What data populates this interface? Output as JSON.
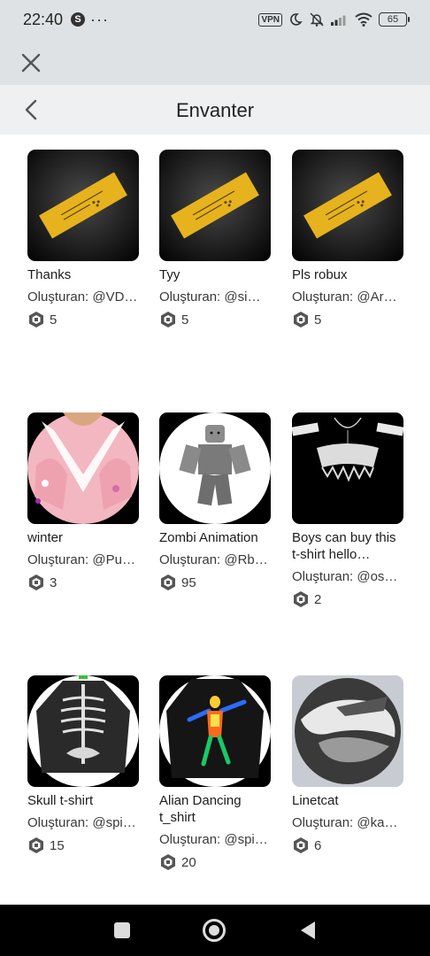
{
  "status_bar": {
    "time": "22:40",
    "vpn": "VPN",
    "battery": "65",
    "icons": [
      "app-s-icon",
      "more-dots-icon",
      "vpn-icon",
      "moon-icon",
      "bell-off-icon",
      "signal-icon",
      "wifi-icon",
      "battery-icon"
    ]
  },
  "header": {
    "title": "Envanter",
    "close_icon": "close-icon",
    "back_icon": "chevron-left-icon"
  },
  "items": [
    {
      "name": "Thanks",
      "creator": "Oluşturan: @VD…",
      "price": "5",
      "thumb": "gold-ticket"
    },
    {
      "name": "Tyy",
      "creator": "Oluşturan: @sim…",
      "price": "5",
      "thumb": "gold-ticket"
    },
    {
      "name": "Pls robux",
      "creator": "Oluşturan: @Ard…",
      "price": "5",
      "thumb": "gold-ticket"
    },
    {
      "name": "winter",
      "creator": "Oluşturan: @Pur…",
      "price": "3",
      "thumb": "pink-jacket"
    },
    {
      "name": "Zombi Animation",
      "creator": "Oluşturan: @Rb…",
      "price": "95",
      "thumb": "zombie-avatar"
    },
    {
      "name": "Boys can buy this t-shirt hello…",
      "creator": "Oluşturan: @os…",
      "price": "2",
      "thumb": "black-gothic-shirt"
    },
    {
      "name": "Skull t-shirt",
      "creator": "Oluşturan: @spi…",
      "price": "15",
      "thumb": "skeleton-shirt"
    },
    {
      "name": "Alian Dancing t_shirt",
      "creator": "Oluşturan: @spi…",
      "price": "20",
      "thumb": "thermal-alien-shirt"
    },
    {
      "name": "Linetcat",
      "creator": "Oluşturan: @kak…",
      "price": "6",
      "thumb": "grey-abstract"
    }
  ],
  "colors": {
    "status_bg": "#dfe2e5",
    "header_bg": "#eef0f2",
    "gold": "#e6b31e",
    "text": "#1c1c1c",
    "nav_bg": "#000000"
  },
  "nav": {
    "icons": [
      "recent-apps-icon",
      "home-icon",
      "back-icon"
    ]
  }
}
